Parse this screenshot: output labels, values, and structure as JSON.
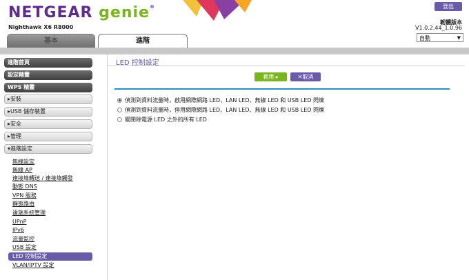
{
  "header": {
    "logo_netgear": "NETGEAR",
    "logo_genie": "genie",
    "logo_tm": "®",
    "model": "Nighthawk X6 R8000",
    "logout": "登出",
    "firmware_label": "韌體版本",
    "firmware_version": "V1.0.2.44_1.0.96",
    "language": "自動"
  },
  "tabs": {
    "basic": "基本",
    "advanced": "進階"
  },
  "sidebar": {
    "buttons": [
      "進階首頁",
      "設定精靈",
      "WPS 精靈"
    ],
    "sections": [
      "▸安裝",
      "▸USB 儲存裝置",
      "▸安全",
      "▸管理",
      "▾進階設定"
    ],
    "sublinks": [
      "無線設定",
      "無線 AP",
      "連接埠轉送 / 連接埠觸發",
      "動態 DNS",
      "VPN 服務",
      "靜態路由",
      "遠端系統管理",
      "UPnP",
      "IPv6",
      "流量監控",
      "USB 設定",
      "LED 控制設定",
      "VLAN/IPTV 設定"
    ]
  },
  "main": {
    "title": "LED 控制設定",
    "apply": "套用 ▸",
    "cancel": "✕取消",
    "options": [
      "偵測到資料流量時，啟用網際網路 LED、LAN LED、無線 LED 和 USB LED 閃爍",
      "偵測到資料流量時，停用網際網路 LED、LAN LED、無線 LED 和 USB LED 閃爍",
      "關閉除電源 LED 之外的所有 LED"
    ]
  },
  "colors": {
    "purple": "#6a5ba8",
    "green": "#7ab51d",
    "blue": "#2a8fbd"
  }
}
